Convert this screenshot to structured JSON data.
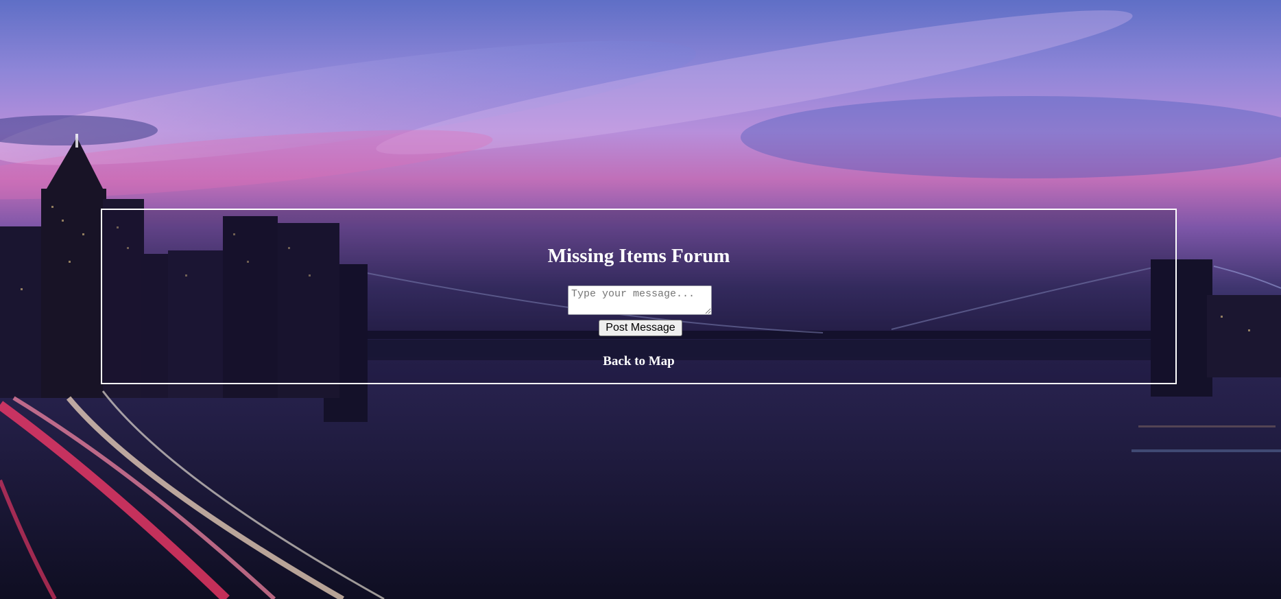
{
  "forum": {
    "title": "Missing Items Forum",
    "message_placeholder": "Type your message...",
    "message_value": "",
    "post_button_label": "Post Message",
    "back_link_label": "Back to Map"
  },
  "background": {
    "sky_color_top": "#5f6fc6",
    "sky_color_pink": "#c06fb8",
    "water_color": "#151430",
    "light_trail_color": "#ff3b6b"
  }
}
